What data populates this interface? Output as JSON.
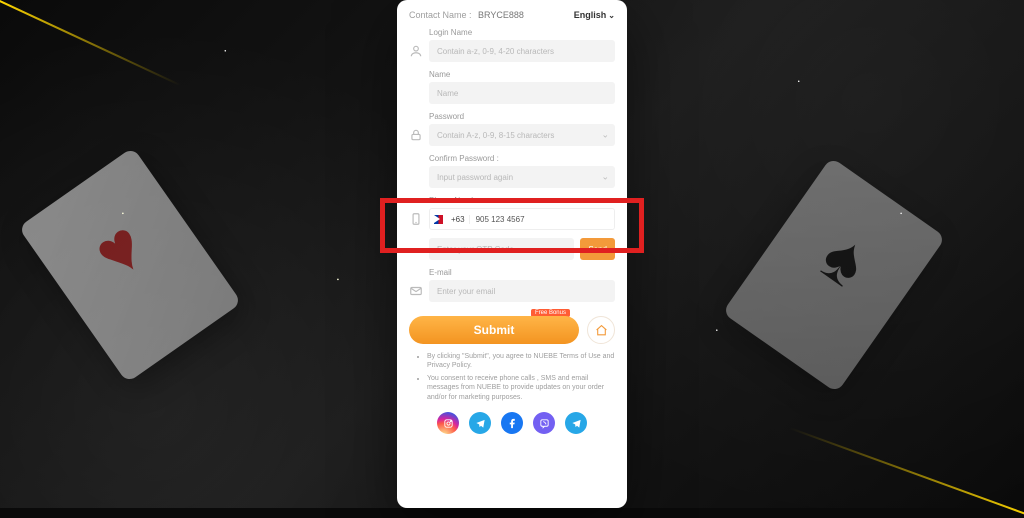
{
  "header": {
    "contact_label": "Contact Name :",
    "contact_value": "BRYCE888",
    "language": "English"
  },
  "form": {
    "login_name": {
      "label": "Login Name",
      "placeholder": "Contain a-z, 0-9, 4-20 characters"
    },
    "name": {
      "label": "Name",
      "placeholder": "Name"
    },
    "password": {
      "label": "Password",
      "placeholder": "Contain A-z, 0-9, 8-15 characters"
    },
    "confirm_password": {
      "label": "Confirm Password :",
      "placeholder": "Input password again"
    },
    "phone": {
      "label": "Phone Number",
      "country_code": "+63",
      "value": "905 123 4567"
    },
    "otp": {
      "placeholder": "Enter your OTP Code",
      "send_label": "Send"
    },
    "email": {
      "label": "E-mail",
      "placeholder": "Enter your email"
    }
  },
  "submit": {
    "label": "Submit",
    "badge": "Free Bonus"
  },
  "terms": {
    "item1": "By clicking \"Submit\", you agree to NUEBE Terms of Use and Privacy Policy.",
    "item2": "You consent to receive phone calls , SMS and email messages from NUEBE to provide updates on your order and/or for marketing purposes."
  },
  "colors": {
    "accent": "#f39a3a",
    "highlight": "#e02020"
  }
}
